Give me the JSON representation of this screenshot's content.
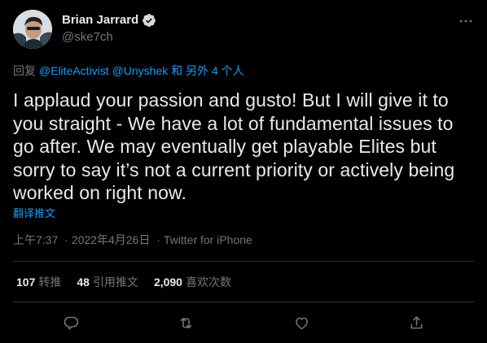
{
  "author": {
    "name": "Brian Jarrard",
    "handle": "@ske7ch",
    "verified": true
  },
  "reply": {
    "prefix": "回复",
    "mention1": "@EliteActivist",
    "mention2": "@Unyshek",
    "suffix": "和 另外 4 个人"
  },
  "tweet": {
    "text": "I applaud your passion and gusto! But I will give it to you straight - We have a lot of fundamental issues to go after. We may eventually get playable Elites but sorry to say it’s not a current priority or actively being worked on right now.",
    "translate_label": "翻译推文"
  },
  "meta": {
    "time": "上午7:37",
    "dot1": "·",
    "date": "2022年4月26日",
    "dot2": "·",
    "source": "Twitter for iPhone"
  },
  "stats": {
    "retweets_count": "107",
    "retweets_label": "转推",
    "quotes_count": "48",
    "quotes_label": "引用推文",
    "likes_count": "2,090",
    "likes_label": "喜欢次数"
  },
  "icons": {
    "more": "more-horizontal-icon",
    "verified": "verified-badge-icon",
    "reply": "reply-icon",
    "retweet": "retweet-icon",
    "like": "like-icon",
    "share": "share-icon"
  },
  "colors": {
    "background": "#000000",
    "text": "#e7e9ea",
    "secondary": "#71767b",
    "accent": "#1d9bf0",
    "divider": "#2f3336"
  }
}
